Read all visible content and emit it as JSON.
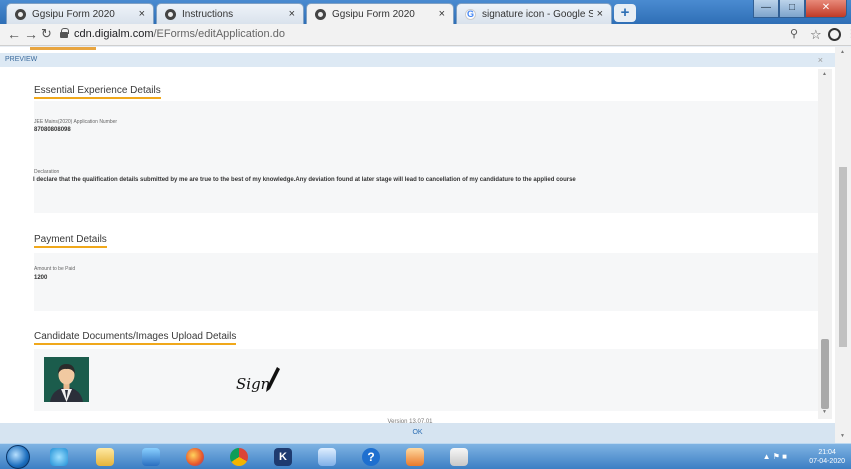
{
  "browser": {
    "tabs": [
      {
        "title": "Ggsipu Form 2020",
        "favicon": "globe-icon",
        "active": false
      },
      {
        "title": "Instructions",
        "favicon": "globe-icon",
        "active": false
      },
      {
        "title": "Ggsipu Form 2020",
        "favicon": "globe-icon",
        "active": true
      },
      {
        "title": "signature icon - Google Search",
        "favicon": "google-icon",
        "active": false
      }
    ],
    "close_glyph": "×",
    "new_tab_glyph": "+",
    "url_domain": "cdn.digialm.com",
    "url_path": "/EForms/editApplication.do"
  },
  "page": {
    "preview_label": "PREVIEW",
    "sections": {
      "experience": {
        "title": "Essential Experience Details",
        "app_number_label": "JEE Mains(2020) Application Number",
        "app_number_value": "87080808098",
        "declaration_label": "Declaration",
        "declaration_value": "I declare that the qualification details submitted by me are true to the best of my knowledge.Any deviation found at later stage will lead to cancellation of my candidature to the applied course"
      },
      "payment": {
        "title": "Payment Details",
        "amount_label": "Amount to be Paid",
        "amount_value": "1200"
      },
      "documents": {
        "title": "Candidate Documents/Images Upload Details",
        "signature_text": "Sign"
      }
    },
    "version": "Version 13.07.01",
    "ok_label": "OK"
  },
  "taskbar": {
    "clock_time": "21:04",
    "clock_date": "07-04-2020",
    "apps": [
      "chrome-icon",
      "ie-icon",
      "folder-icon",
      "media-player-icon",
      "firefox-icon",
      "chrome-icon",
      "app-k-icon",
      "word-icon",
      "help-icon",
      "photos-icon",
      "paint-icon"
    ]
  },
  "colors": {
    "accent_underline": "#f0a81b",
    "preview_bar": "#dde9f4",
    "taskbar": "#3c7fc4"
  }
}
